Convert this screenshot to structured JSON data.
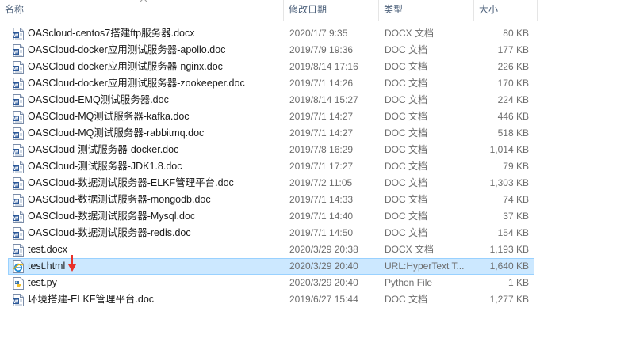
{
  "columns": {
    "name": "名称",
    "date": "修改日期",
    "type": "类型",
    "size": "大小"
  },
  "accent": "#cce8ff",
  "files": [
    {
      "name": "OAScloud-centos7搭建ftp服务器.docx",
      "date": "2020/1/7 9:35",
      "type": "DOCX 文档",
      "size": "80 KB",
      "icon": "word-document-icon"
    },
    {
      "name": "OASCloud-docker应用测试服务器-apollo.doc",
      "date": "2019/7/9 19:36",
      "type": "DOC 文档",
      "size": "177 KB",
      "icon": "word-document-icon"
    },
    {
      "name": "OASCloud-docker应用测试服务器-nginx.doc",
      "date": "2019/8/14 17:16",
      "type": "DOC 文档",
      "size": "226 KB",
      "icon": "word-document-icon"
    },
    {
      "name": "OASCloud-docker应用测试服务器-zookeeper.doc",
      "date": "2019/7/1 14:26",
      "type": "DOC 文档",
      "size": "170 KB",
      "icon": "word-document-icon"
    },
    {
      "name": "OASCloud-EMQ测试服务器.doc",
      "date": "2019/8/14 15:27",
      "type": "DOC 文档",
      "size": "224 KB",
      "icon": "word-document-icon"
    },
    {
      "name": "OASCloud-MQ测试服务器-kafka.doc",
      "date": "2019/7/1 14:27",
      "type": "DOC 文档",
      "size": "446 KB",
      "icon": "word-document-icon"
    },
    {
      "name": "OASCloud-MQ测试服务器-rabbitmq.doc",
      "date": "2019/7/1 14:27",
      "type": "DOC 文档",
      "size": "518 KB",
      "icon": "word-document-icon"
    },
    {
      "name": "OASCloud-测试服务器-docker.doc",
      "date": "2019/7/8 16:29",
      "type": "DOC 文档",
      "size": "1,014 KB",
      "icon": "word-document-icon"
    },
    {
      "name": "OASCloud-测试服务器-JDK1.8.doc",
      "date": "2019/7/1 17:27",
      "type": "DOC 文档",
      "size": "79 KB",
      "icon": "word-document-icon"
    },
    {
      "name": "OASCloud-数据测试服务器-ELKF管理平台.doc",
      "date": "2019/7/2 11:05",
      "type": "DOC 文档",
      "size": "1,303 KB",
      "icon": "word-document-icon"
    },
    {
      "name": "OASCloud-数据测试服务器-mongodb.doc",
      "date": "2019/7/1 14:33",
      "type": "DOC 文档",
      "size": "74 KB",
      "icon": "word-document-icon"
    },
    {
      "name": "OASCloud-数据测试服务器-Mysql.doc",
      "date": "2019/7/1 14:40",
      "type": "DOC 文档",
      "size": "37 KB",
      "icon": "word-document-icon"
    },
    {
      "name": "OASCloud-数据测试服务器-redis.doc",
      "date": "2019/7/1 14:50",
      "type": "DOC 文档",
      "size": "154 KB",
      "icon": "word-document-icon"
    },
    {
      "name": "test.docx",
      "date": "2020/3/29 20:38",
      "type": "DOCX 文档",
      "size": "1,193 KB",
      "icon": "word-document-icon"
    },
    {
      "name": "test.html",
      "date": "2020/3/29 20:40",
      "type": "URL:HyperText T...",
      "size": "1,640 KB",
      "icon": "ie-html-icon",
      "selected": true
    },
    {
      "name": "test.py",
      "date": "2020/3/29 20:40",
      "type": "Python File",
      "size": "1 KB",
      "icon": "python-file-icon"
    },
    {
      "name": "环境搭建-ELKF管理平台.doc",
      "date": "2019/6/27 15:44",
      "type": "DOC 文档",
      "size": "1,277 KB",
      "icon": "word-document-icon"
    }
  ]
}
